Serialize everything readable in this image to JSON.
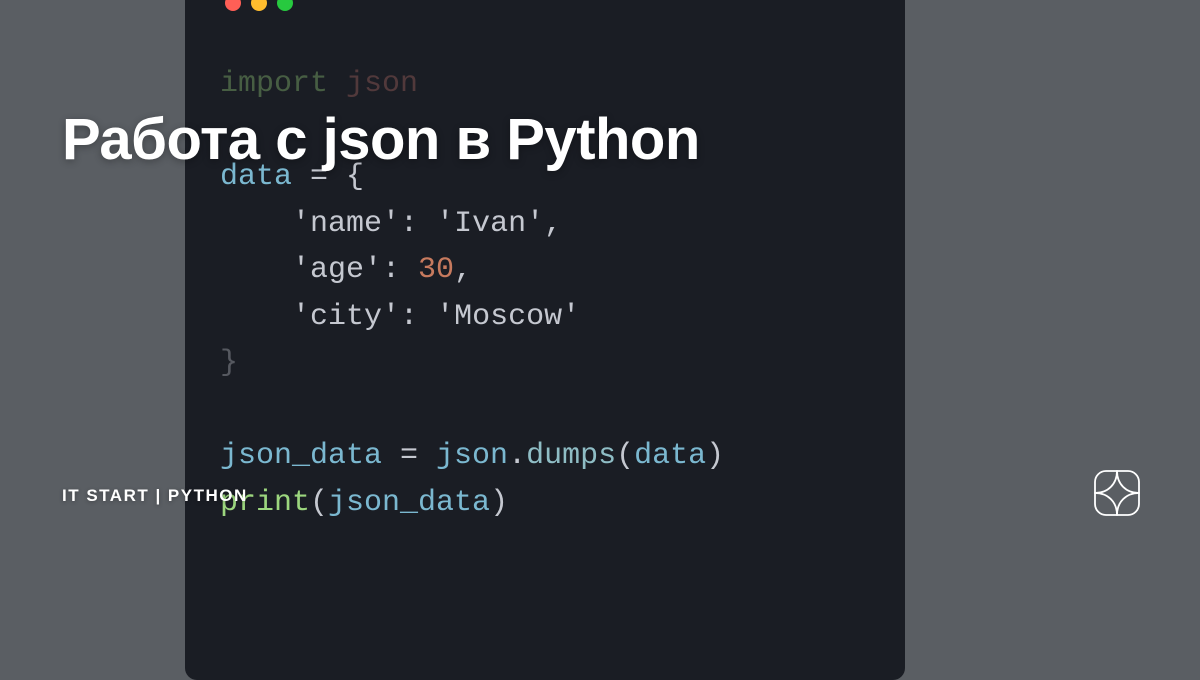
{
  "title": "Работа с json в Python",
  "subtitle": "IT START | PYTHON",
  "code": {
    "line_import_kw": "import",
    "line_import_mod": "json",
    "line_data_var": "data",
    "line_data_eq": " = {",
    "kv1_key": "'name'",
    "kv1_val": "'Ivan'",
    "kv2_key": "'age'",
    "kv2_val": "30",
    "kv3_key": "'city'",
    "kv3_val": "'Moscow'",
    "close_brace": "}",
    "jd_var": "json_data",
    "jd_eq": " = ",
    "jd_mod": "json",
    "jd_dot": ".",
    "jd_method": "dumps",
    "jd_open": "(",
    "jd_arg": "data",
    "jd_close": ")",
    "print_fn": "print",
    "print_open": "(",
    "print_arg": "json_data",
    "print_close": ")"
  }
}
